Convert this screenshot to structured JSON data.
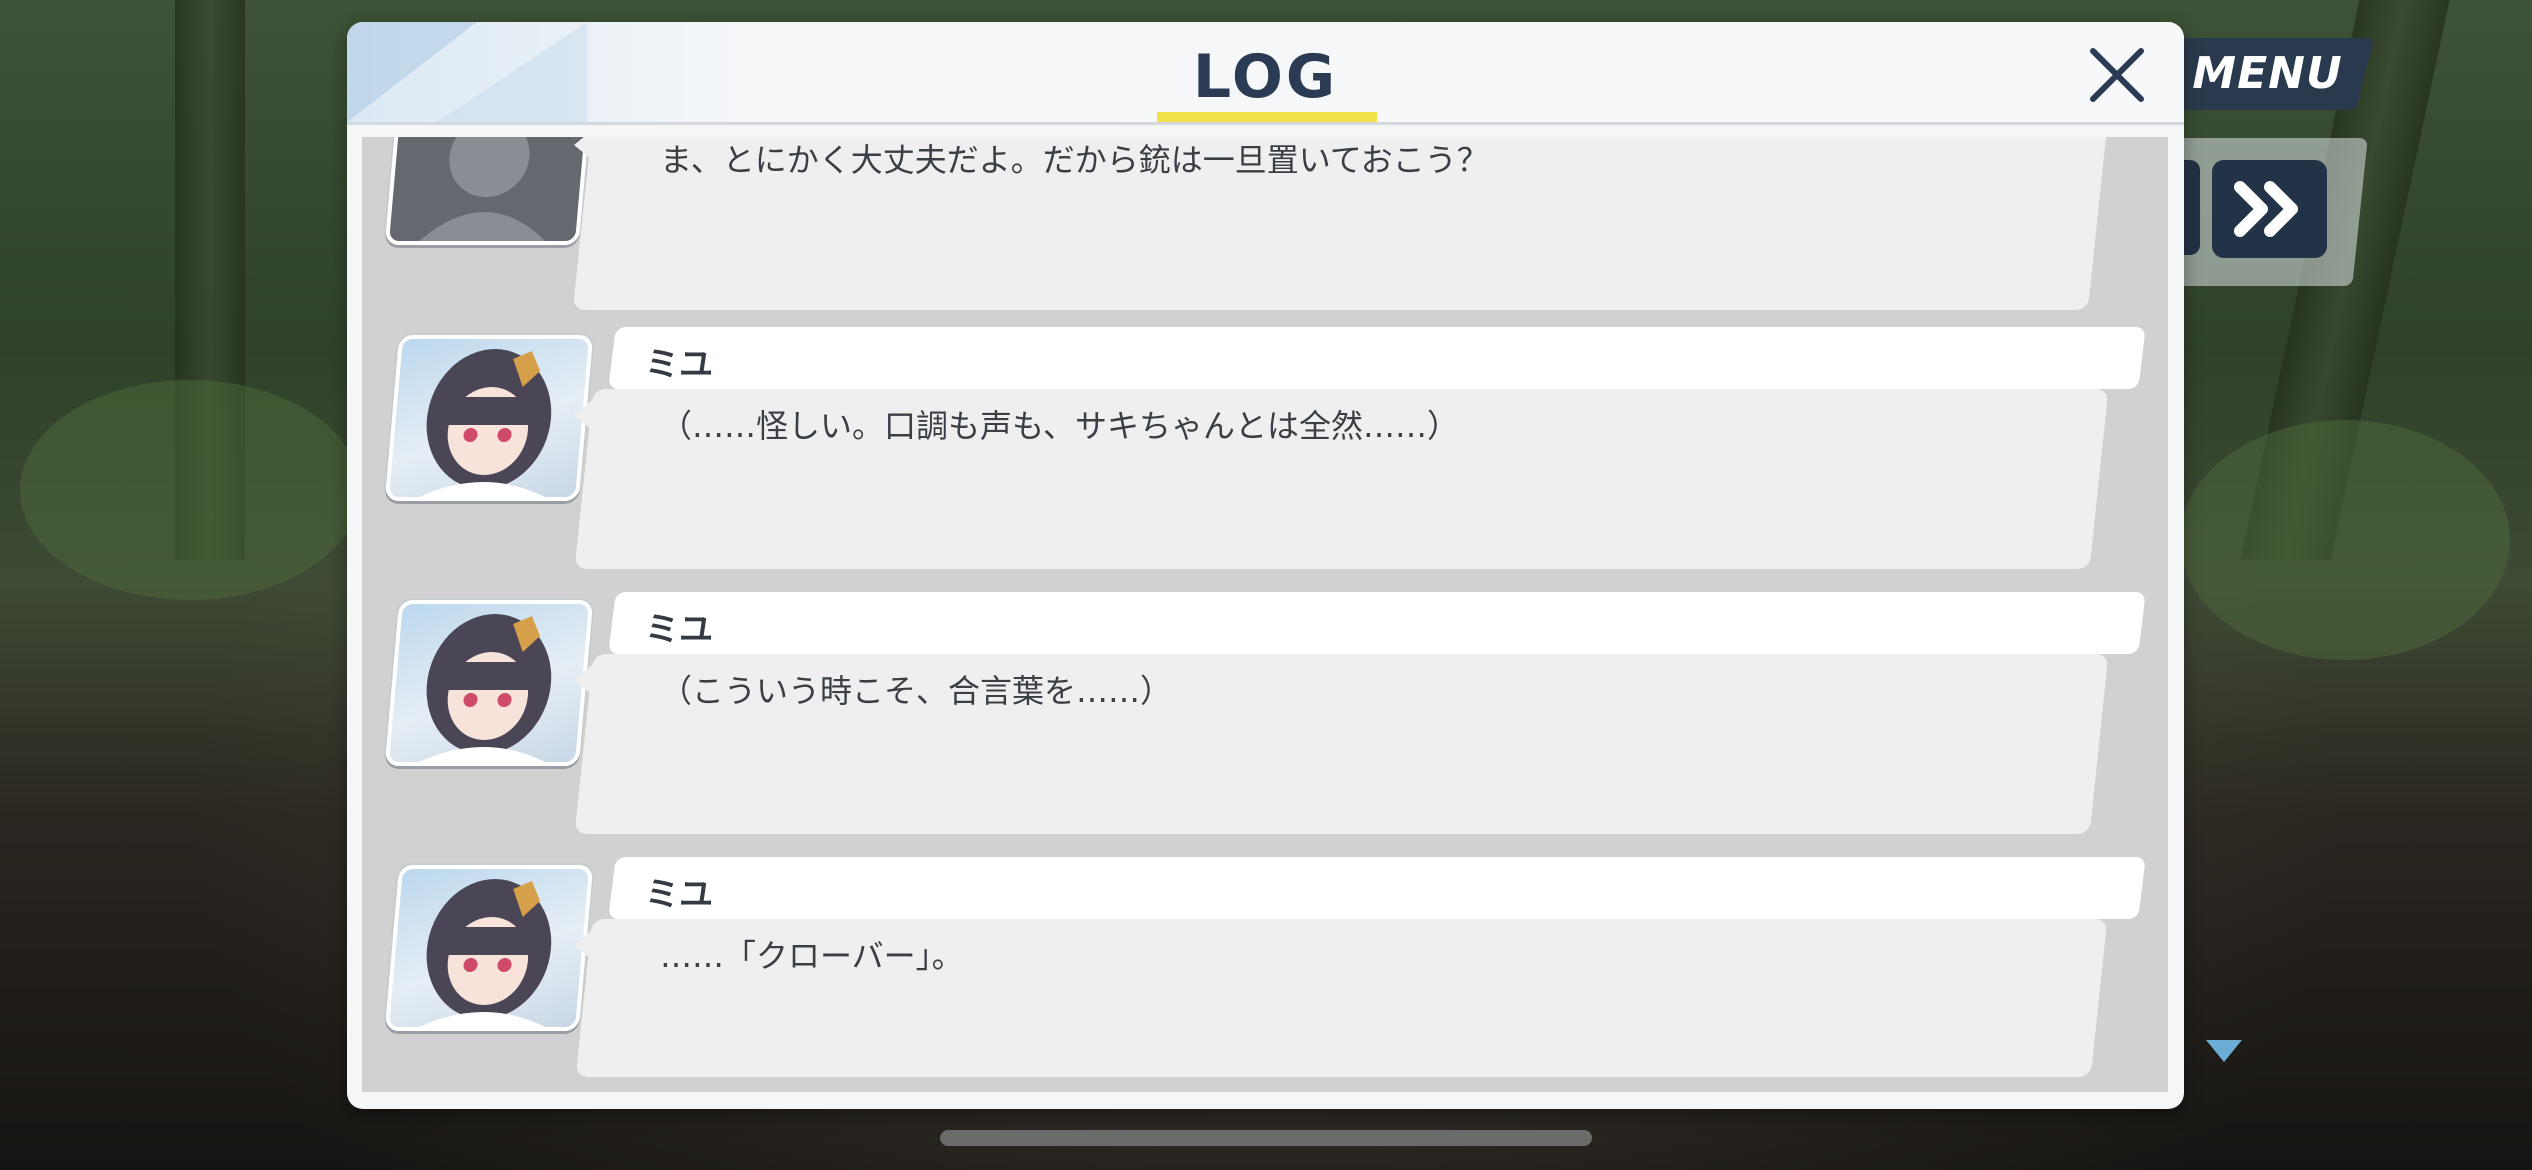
{
  "log": {
    "title": "LOG",
    "close_label": "×",
    "entries": [
      {
        "speaker": "",
        "avatar": "silhouette-avatar",
        "text": "ま、とにかく大丈夫だよ。だから銃は一旦置いておこう？"
      },
      {
        "speaker": "ミユ",
        "avatar": "miyu-portrait",
        "text": "（……怪しい。口調も声も、サキちゃんとは全然……）"
      },
      {
        "speaker": "ミユ",
        "avatar": "miyu-portrait",
        "text": "（こういう時こそ、合言葉を……）"
      },
      {
        "speaker": "ミユ",
        "avatar": "miyu-portrait",
        "text": "……「クローバー」。"
      }
    ]
  },
  "hud": {
    "menu_label": "MENU",
    "skip_icon": "fast-forward-icon",
    "indicator_icon": "down-triangle-icon"
  },
  "colors": {
    "title_text": "#2b3b54",
    "title_underline": "#f2e04a",
    "hud_button": "#223247"
  }
}
